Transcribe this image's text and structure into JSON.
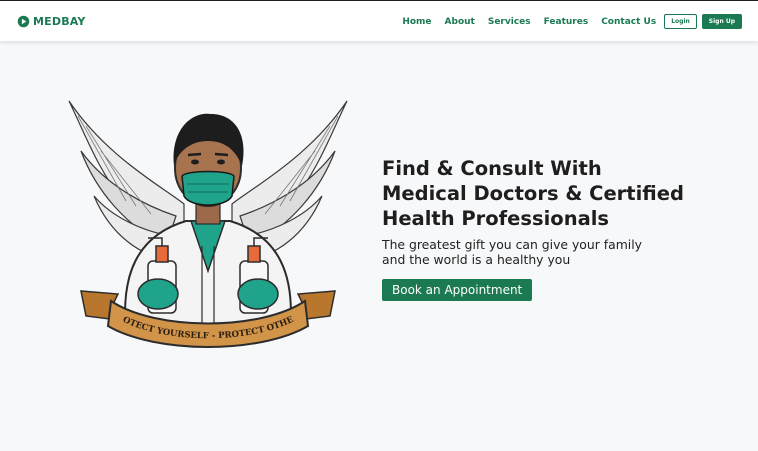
{
  "brand": {
    "name": "MEDBAY",
    "icon": "play-logo-icon",
    "color": "#1b7a52"
  },
  "nav": {
    "items": [
      "Home",
      "About",
      "Services",
      "Features",
      "Contact Us"
    ],
    "login_label": "Login",
    "signup_label": "Sign Up"
  },
  "hero": {
    "title_lines": [
      "Find & Consult With",
      "Medical Doctors & Certified",
      "Health Professionals"
    ],
    "subtitle_lines": [
      "The greatest gift you can give your family",
      "and the world is a healthy you"
    ],
    "cta_label": "Book an Appointment",
    "banner_text": "PROTECT YOURSELF - PROTECT OTHERS",
    "illustration": "winged-doctor-with-mask-illustration"
  },
  "colors": {
    "accent": "#1b7a52",
    "page_bg": "#f7f8fa",
    "banner": "#c98a3e"
  }
}
